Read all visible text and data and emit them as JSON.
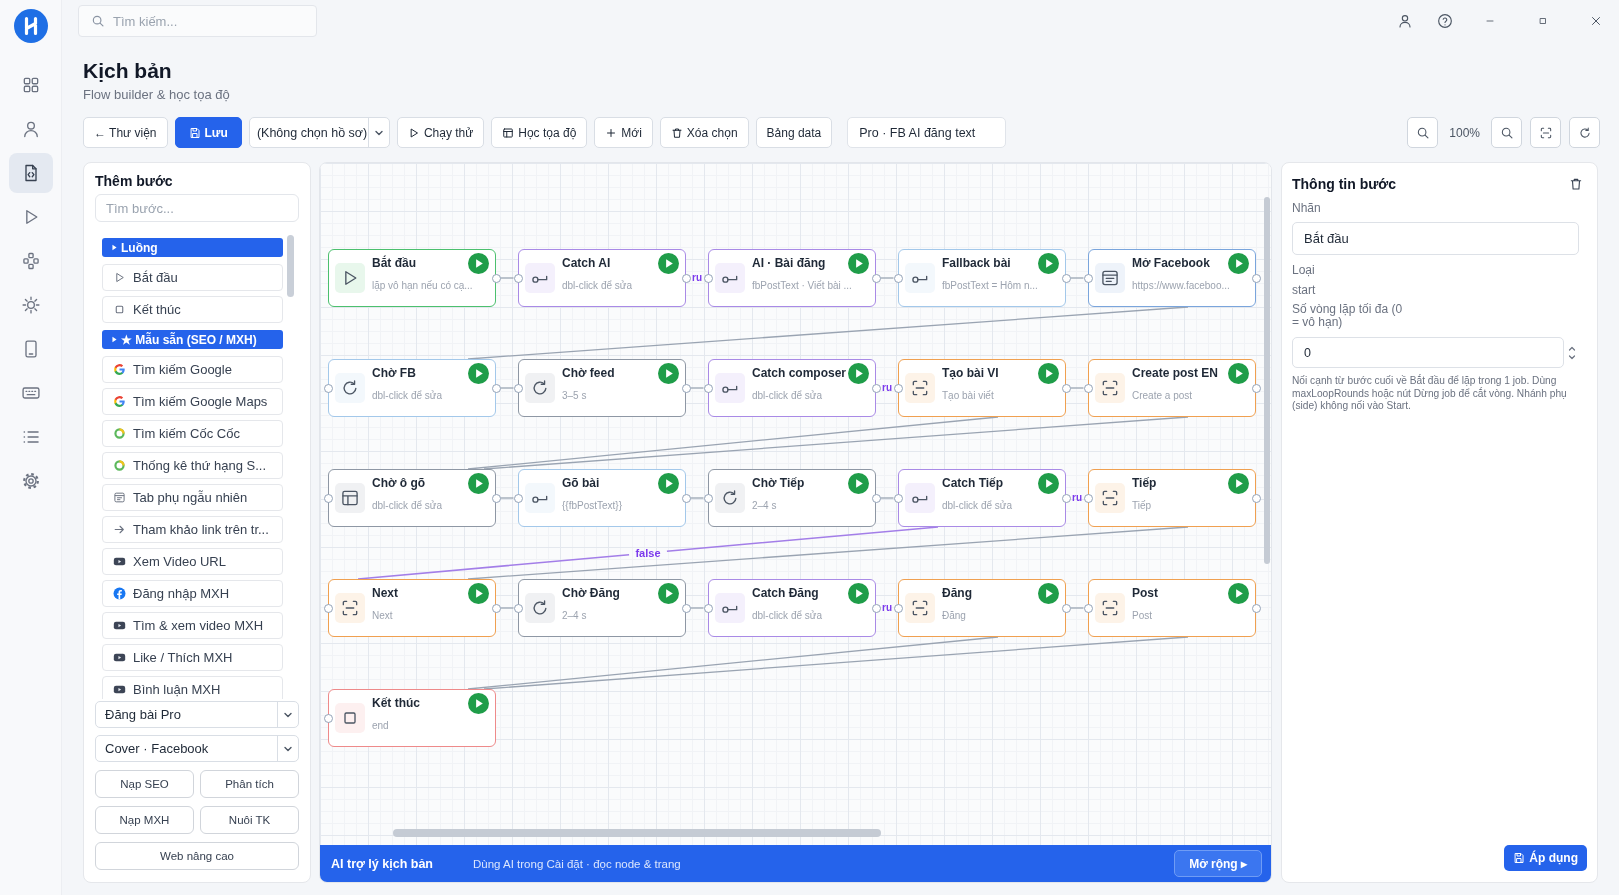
{
  "rail": [
    {
      "kind": "dashboard",
      "selected": false
    },
    {
      "kind": "user",
      "selected": false
    },
    {
      "kind": "scripts",
      "selected": true
    },
    {
      "kind": "run",
      "selected": false
    },
    {
      "kind": "nodes",
      "selected": false
    },
    {
      "kind": "sun",
      "selected": false
    },
    {
      "kind": "phone",
      "selected": false
    },
    {
      "kind": "keyboard",
      "selected": false
    },
    {
      "kind": "list",
      "selected": false
    },
    {
      "kind": "settings",
      "selected": false
    }
  ],
  "search": {
    "placeholder": "Tìm kiếm..."
  },
  "header": {
    "title": "Kịch bản",
    "subtitle": "Flow builder & học tọa độ"
  },
  "toolbar": [
    {
      "kind": "plain",
      "label": "← Thư viện"
    },
    {
      "kind": "save",
      "label": "Lưu"
    },
    {
      "kind": "select",
      "value": "(Không chọn hồ sơ)"
    },
    {
      "kind": "run",
      "label": "Chạy thử"
    },
    {
      "kind": "coords",
      "label": "Học tọa độ"
    },
    {
      "kind": "new",
      "label": "Mới"
    },
    {
      "kind": "clear",
      "label": "Xóa chọn"
    },
    {
      "kind": "plain",
      "label": "Bảng data"
    },
    {
      "kind": "name",
      "value": "Pro · FB AI đăng text"
    }
  ],
  "zoom_controls": {
    "zoom": "100%"
  },
  "steps_panel": {
    "title": "Thêm bước",
    "search_placeholder": "Tìm bước...",
    "items": [
      {
        "kind": "group",
        "label": "Luồng"
      },
      {
        "kind": "start",
        "label": "Bắt đầu"
      },
      {
        "kind": "end",
        "label": "Kết thúc"
      },
      {
        "kind": "group",
        "label": "★ Mẫu sẵn (SEO / MXH)"
      },
      {
        "kind": "google",
        "label": "Tìm kiếm Google"
      },
      {
        "kind": "google",
        "label": "Tìm kiếm Google Maps"
      },
      {
        "kind": "coccoc",
        "label": "Tìm kiếm Cốc Cốc"
      },
      {
        "kind": "coccoc",
        "label": "Thống kê thứ hạng S..."
      },
      {
        "kind": "tab",
        "label": "Tab phụ ngẫu nhiên"
      },
      {
        "kind": "link",
        "label": "Tham khảo link trên tr..."
      },
      {
        "kind": "video",
        "label": "Xem Video URL"
      },
      {
        "kind": "facebook",
        "label": "Đăng nhập MXH"
      },
      {
        "kind": "video",
        "label": "Tìm & xem video MXH"
      },
      {
        "kind": "video",
        "label": "Like / Thích MXH"
      },
      {
        "kind": "video",
        "label": "Bình luận MXH"
      }
    ],
    "selects": [
      "Đăng bài Pro",
      "Cover · Facebook"
    ],
    "buttons": [
      "Nạp SEO",
      "Phân tích",
      "Nạp MXH",
      "Nuôi TK",
      "Web nâng cao"
    ]
  },
  "canvas": {
    "rows": [
      [
        {
          "title": "Bắt đầu",
          "subtitle": "lặp vô hạn nếu có cạ...",
          "kind": "start",
          "color": "#4cc06e",
          "links_down": false
        },
        {
          "title": "Catch AI",
          "subtitle": "dbl-click để sửa",
          "kind": "catch",
          "color": "#a98ae6",
          "links_down": false,
          "out_label": "ru"
        },
        {
          "title": "AI · Bài đăng",
          "subtitle": "fbPostText · Viết bài ...",
          "kind": "catch",
          "color": "#a98ae6",
          "links_down": false
        },
        {
          "title": "Fallback bài",
          "subtitle": "fbPostText = Hôm n...",
          "kind": "catch",
          "color": "#a3c8ea",
          "links_down": false
        },
        {
          "title": "Mở Facebook",
          "subtitle": "https://www.faceboo...",
          "kind": "browser",
          "color": "#7aa5dc",
          "links_down": true
        }
      ],
      [
        {
          "title": "Chờ FB",
          "subtitle": "dbl-click để sửa",
          "kind": "wait",
          "color": "#a3c8ea",
          "links_down": false
        },
        {
          "title": "Chờ feed",
          "subtitle": "3–5 s",
          "kind": "wait",
          "color": "#8e97a4",
          "links_down": false
        },
        {
          "title": "Catch composer",
          "subtitle": "dbl-click để sửa",
          "kind": "catch",
          "color": "#a98ae6",
          "links_down": false,
          "out_label": "ru"
        },
        {
          "title": "Tạo bài VI",
          "subtitle": "Tạo bài viết",
          "kind": "capture",
          "color": "#f0a050",
          "links_down": true
        },
        {
          "title": "Create post EN",
          "subtitle": "Create a post",
          "kind": "capture",
          "color": "#f0a050",
          "links_down": true
        }
      ],
      [
        {
          "title": "Chờ ô gõ",
          "subtitle": "dbl-click để sửa",
          "kind": "layout",
          "color": "#8e97a4",
          "links_down": false
        },
        {
          "title": "Gõ bài",
          "subtitle": "{{fbPostText}}",
          "kind": "catch",
          "color": "#a3c8ea",
          "links_down": false
        },
        {
          "title": "Chờ Tiếp",
          "subtitle": "2–4 s",
          "kind": "wait",
          "color": "#8e97a4",
          "links_down": false
        },
        {
          "title": "Catch Tiếp",
          "subtitle": "dbl-click để sửa",
          "kind": "catch",
          "color": "#a98ae6",
          "links_down": false,
          "out_label": "ru",
          "branch_label": "false"
        },
        {
          "title": "Tiếp",
          "subtitle": "Tiếp",
          "kind": "capture",
          "color": "#f0a050",
          "links_down": true
        }
      ],
      [
        {
          "title": "Next",
          "subtitle": "Next",
          "kind": "capture",
          "color": "#f0a050",
          "links_down": false
        },
        {
          "title": "Chờ Đăng",
          "subtitle": "2–4 s",
          "kind": "wait",
          "color": "#8e97a4",
          "links_down": false
        },
        {
          "title": "Catch Đăng",
          "subtitle": "dbl-click để sửa",
          "kind": "catch",
          "color": "#a98ae6",
          "links_down": false,
          "out_label": "ru"
        },
        {
          "title": "Đăng",
          "subtitle": "Đăng",
          "kind": "capture",
          "color": "#f0a050",
          "links_down": true
        },
        {
          "title": "Post",
          "subtitle": "Post",
          "kind": "capture",
          "color": "#f0a050",
          "links_down": true
        }
      ],
      [
        {
          "title": "Kết thúc",
          "subtitle": "end",
          "kind": "end",
          "color": "#ee8a8a",
          "links_down": false
        }
      ]
    ]
  },
  "ai_bar": {
    "title": "AI trợ lý kịch bản",
    "hint": "Dùng AI trong Cài đặt · đọc node & trang",
    "button": "Mở rộng ▸"
  },
  "inspector": {
    "title": "Thông tin bước",
    "fields": [
      {
        "kind": "text",
        "label": "Nhãn",
        "value": "Bắt đầu"
      },
      {
        "kind": "static",
        "label": "Loại",
        "value": "start"
      },
      {
        "kind": "number",
        "label": "Số vòng lặp tối đa (0 = vô hạn)",
        "value": "0"
      }
    ],
    "note": "Nối cạnh từ bước cuối về Bắt đầu để lặp trong 1 job. Dùng maxLoopRounds hoặc nút Dừng job để cắt vòng. Nhánh phụ (side) không nối vào Start.",
    "apply": "Áp dụng"
  }
}
